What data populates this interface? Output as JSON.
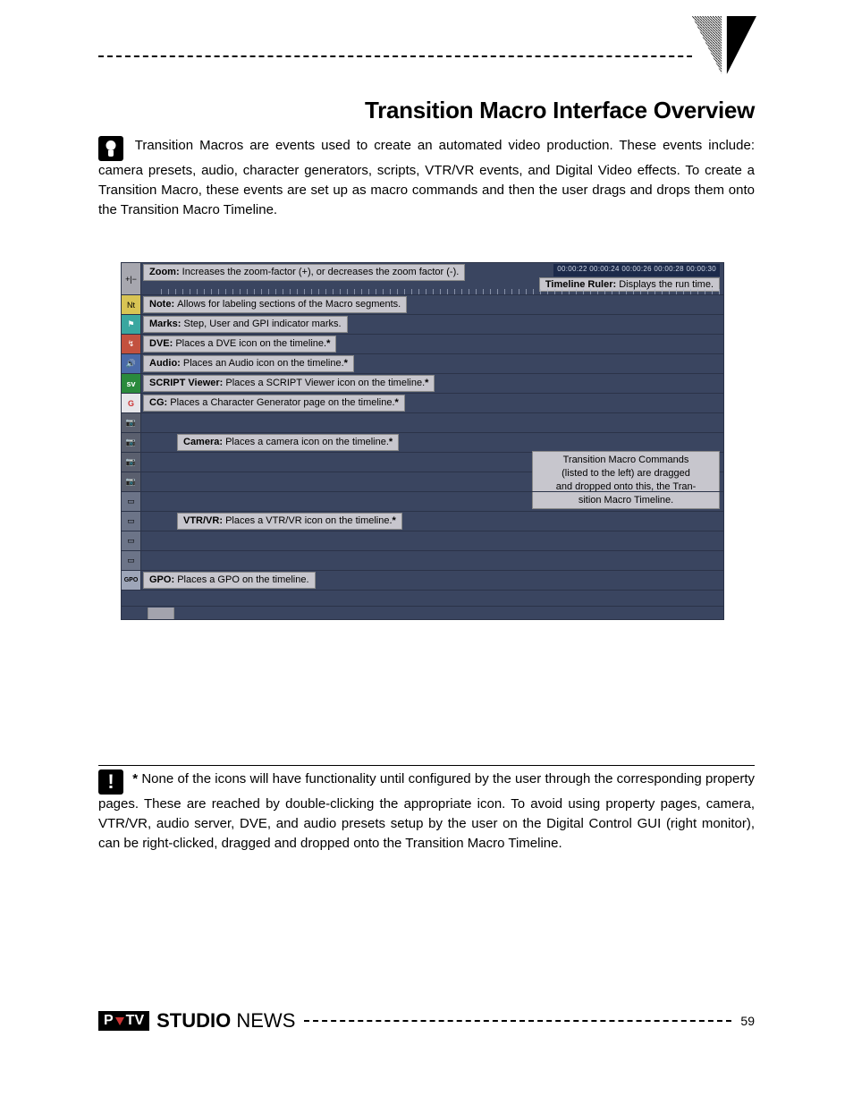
{
  "title": "Transition Macro Interface Overview",
  "intro": "Transition Macros are events used to create an automated video production.  These events include:  camera presets, audio, character generators, scripts, VTR/VR events, and Digital Video effects.  To create a Transition Macro, these events are set up as macro commands and then the user drags and drops them onto the Transition Macro Timeline.",
  "callouts": {
    "zoom": {
      "label": "Zoom:",
      "text": "Increases the zoom-factor (+), or decreases the zoom factor (-)."
    },
    "ruler": {
      "label": "Timeline Ruler:",
      "text": "Displays the run time."
    },
    "note": {
      "label": "Note:",
      "text": "Allows for labeling sections of the Macro segments."
    },
    "marks": {
      "label": "Marks:",
      "text": "Step, User and GPI indicator marks."
    },
    "dve": {
      "label": "DVE:",
      "text": "Places a DVE icon on the timeline."
    },
    "audio": {
      "label": "Audio:",
      "text": "Places an Audio icon on the timeline."
    },
    "script": {
      "label": "SCRIPT Viewer:",
      "text": "Places a SCRIPT Viewer icon on the timeline."
    },
    "cg": {
      "label": "CG:",
      "text": "Places a Character Generator page on the timeline."
    },
    "camera": {
      "label": "Camera:",
      "text": "Places a camera icon on the timeline."
    },
    "vtr": {
      "label": "VTR/VR:",
      "text": "Places a VTR/VR icon on the timeline."
    },
    "gpo": {
      "label": "GPO:",
      "text": "Places a GPO on the timeline."
    }
  },
  "asterisk": "*",
  "ruler_times": "00:00:22   00:00:24   00:00:26   00:00:28   00:00:30",
  "cmd_box": {
    "l1": "Transition Macro Commands",
    "l2": "(listed to the left) are dragged",
    "l3": "and dropped onto this, the Tran-",
    "l4": "sition Macro Timeline."
  },
  "icons": {
    "zoom": "+|−",
    "note": "Nt",
    "marks": "⚑",
    "dve": "↯",
    "audio": "🔊",
    "script": "sv",
    "cg": "G",
    "cam": "📷",
    "vtr": "▭",
    "gpo": "GPO"
  },
  "footnote": "None of the icons will have functionality until configured by the user through the corresponding property pages.  These are reached by double-clicking the appropriate icon. To avoid using property pages, camera, VTR/VR, audio server, DVE, and audio presets setup by the user on the Digital Control GUI (right monitor), can be right-clicked, dragged and dropped onto the Transition Macro Timeline.",
  "footer": {
    "logo_left": "P",
    "logo_right": "TV",
    "brand_bold": "STUDIO",
    "brand_light": " NEWS",
    "page": "59"
  }
}
